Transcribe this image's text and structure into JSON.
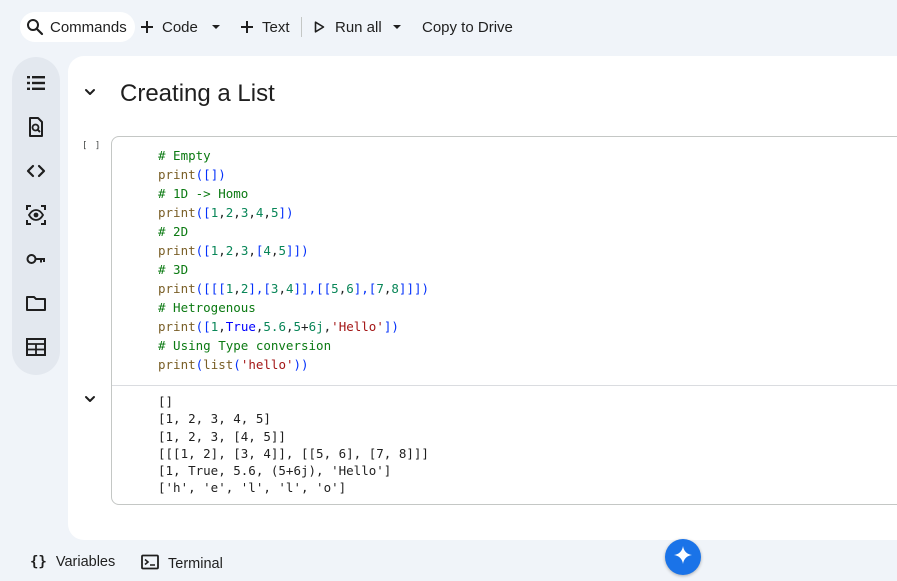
{
  "toolbar": {
    "commands_label": "Commands",
    "code_label": "Code",
    "text_label": "Text",
    "run_all_label": "Run all",
    "copy_to_drive_label": "Copy to Drive"
  },
  "rail": {
    "icons": [
      "table-of-contents-icon",
      "find-replace-icon",
      "code-snippets-icon",
      "variables-inspector-icon",
      "secrets-key-icon",
      "files-folder-icon",
      "data-table-icon"
    ]
  },
  "section": {
    "heading": "Creating a List"
  },
  "cell": {
    "exec_indicator": "[ ]",
    "code_lines": [
      [
        {
          "t": "# Empty",
          "c": "comment"
        }
      ],
      [
        {
          "t": "print",
          "c": "fn"
        },
        {
          "t": "([])",
          "c": "bracket"
        }
      ],
      [
        {
          "t": "# 1D -> Homo",
          "c": "comment"
        }
      ],
      [
        {
          "t": "print",
          "c": "fn"
        },
        {
          "t": "([",
          "c": "bracket"
        },
        {
          "t": "1",
          "c": "num"
        },
        {
          "t": ",",
          "c": "p"
        },
        {
          "t": "2",
          "c": "num"
        },
        {
          "t": ",",
          "c": "p"
        },
        {
          "t": "3",
          "c": "num"
        },
        {
          "t": ",",
          "c": "p"
        },
        {
          "t": "4",
          "c": "num"
        },
        {
          "t": ",",
          "c": "p"
        },
        {
          "t": "5",
          "c": "num"
        },
        {
          "t": "])",
          "c": "bracket"
        }
      ],
      [
        {
          "t": "# 2D",
          "c": "comment"
        }
      ],
      [
        {
          "t": "print",
          "c": "fn"
        },
        {
          "t": "([",
          "c": "bracket"
        },
        {
          "t": "1",
          "c": "num"
        },
        {
          "t": ",",
          "c": "p"
        },
        {
          "t": "2",
          "c": "num"
        },
        {
          "t": ",",
          "c": "p"
        },
        {
          "t": "3",
          "c": "num"
        },
        {
          "t": ",",
          "c": "p"
        },
        {
          "t": "[",
          "c": "bracket"
        },
        {
          "t": "4",
          "c": "num"
        },
        {
          "t": ",",
          "c": "p"
        },
        {
          "t": "5",
          "c": "num"
        },
        {
          "t": "]])",
          "c": "bracket"
        }
      ],
      [
        {
          "t": "# 3D",
          "c": "comment"
        }
      ],
      [
        {
          "t": "print",
          "c": "fn"
        },
        {
          "t": "([[[",
          "c": "bracket"
        },
        {
          "t": "1",
          "c": "num"
        },
        {
          "t": ",",
          "c": "p"
        },
        {
          "t": "2",
          "c": "num"
        },
        {
          "t": "],[",
          "c": "bracket"
        },
        {
          "t": "3",
          "c": "num"
        },
        {
          "t": ",",
          "c": "p"
        },
        {
          "t": "4",
          "c": "num"
        },
        {
          "t": "]],[[",
          "c": "bracket"
        },
        {
          "t": "5",
          "c": "num"
        },
        {
          "t": ",",
          "c": "p"
        },
        {
          "t": "6",
          "c": "num"
        },
        {
          "t": "],[",
          "c": "bracket"
        },
        {
          "t": "7",
          "c": "num"
        },
        {
          "t": ",",
          "c": "p"
        },
        {
          "t": "8",
          "c": "num"
        },
        {
          "t": "]]])",
          "c": "bracket"
        }
      ],
      [
        {
          "t": "# Hetrogenous",
          "c": "comment"
        }
      ],
      [
        {
          "t": "print",
          "c": "fn"
        },
        {
          "t": "([",
          "c": "bracket"
        },
        {
          "t": "1",
          "c": "num"
        },
        {
          "t": ",",
          "c": "p"
        },
        {
          "t": "True",
          "c": "kw"
        },
        {
          "t": ",",
          "c": "p"
        },
        {
          "t": "5.6",
          "c": "num"
        },
        {
          "t": ",",
          "c": "p"
        },
        {
          "t": "5",
          "c": "num"
        },
        {
          "t": "+",
          "c": "p"
        },
        {
          "t": "6j",
          "c": "num"
        },
        {
          "t": ",",
          "c": "p"
        },
        {
          "t": "'Hello'",
          "c": "str"
        },
        {
          "t": "])",
          "c": "bracket"
        }
      ],
      [
        {
          "t": "# Using Type conversion",
          "c": "comment"
        }
      ],
      [
        {
          "t": "print",
          "c": "fn"
        },
        {
          "t": "(",
          "c": "bracket"
        },
        {
          "t": "list",
          "c": "fn"
        },
        {
          "t": "(",
          "c": "bracket"
        },
        {
          "t": "'hello'",
          "c": "str"
        },
        {
          "t": "))",
          "c": "bracket"
        }
      ]
    ],
    "output_lines": [
      "[]",
      "[1, 2, 3, 4, 5]",
      "[1, 2, 3, [4, 5]]",
      "[[[1, 2], [3, 4]], [[5, 6], [7, 8]]]",
      "[1, True, 5.6, (5+6j), 'Hello']",
      "['h', 'e', 'l', 'l', 'o']"
    ]
  },
  "bottom_bar": {
    "variables_label": "Variables",
    "terminal_label": "Terminal",
    "variables_glyph": "{}"
  },
  "colors": {
    "background": "#f0f4f9",
    "comment": "#0b7a12",
    "function": "#795e26",
    "number": "#098658",
    "bracket": "#0431fa",
    "keyword": "#0000ff",
    "string": "#a31515",
    "gemini": "#1a73e8"
  }
}
